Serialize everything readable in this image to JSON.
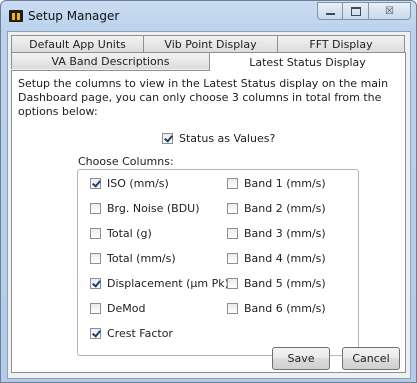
{
  "window": {
    "title": "Setup Manager",
    "caption_buttons": {
      "close_glyph": "☒"
    }
  },
  "tabs": {
    "back_row": [
      "Default App Units",
      "Vib Point Display",
      "FFT Display"
    ],
    "front_row": [
      "VA Band Descriptions",
      "Latest Status Display"
    ],
    "selected": "Latest Status Display"
  },
  "panel": {
    "description": "Setup the columns to view in the Latest Status display on the main Dashboard page, you can only choose 3 columns in total from the options below:",
    "status_as_values": {
      "label": "Status as Values?",
      "checked": true
    },
    "group_title": "Choose Columns:",
    "left_column": [
      {
        "label": "ISO (mm/s)",
        "checked": true
      },
      {
        "label": "Brg. Noise (BDU)",
        "checked": false
      },
      {
        "label": "Total (g)",
        "checked": false
      },
      {
        "label": "Total (mm/s)",
        "checked": false
      },
      {
        "label": "Displacement (µm Pk)",
        "checked": true
      },
      {
        "label": "DeMod",
        "checked": false
      },
      {
        "label": "Crest Factor",
        "checked": true
      }
    ],
    "right_column": [
      {
        "label": "Band 1 (mm/s)",
        "checked": false
      },
      {
        "label": "Band 2 (mm/s)",
        "checked": false
      },
      {
        "label": "Band 3 (mm/s)",
        "checked": false
      },
      {
        "label": "Band 4 (mm/s)",
        "checked": false
      },
      {
        "label": "Band 5 (mm/s)",
        "checked": false
      },
      {
        "label": "Band 6 (mm/s)",
        "checked": false
      }
    ]
  },
  "buttons": {
    "save": "Save",
    "cancel": "Cancel"
  }
}
